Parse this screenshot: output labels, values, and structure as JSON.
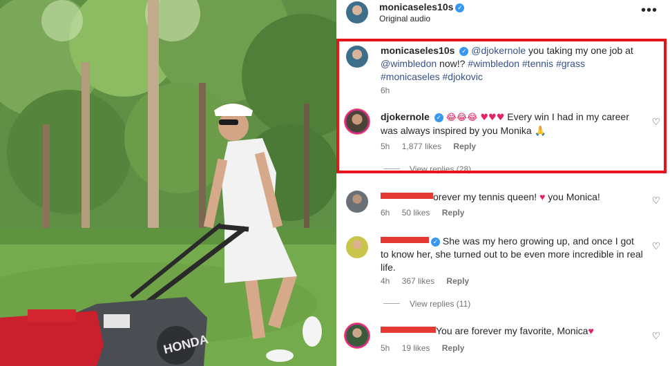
{
  "post": {
    "username": "monicaseles10s",
    "audio": "Original audio",
    "more_label": "•••"
  },
  "photo": {
    "mower_brand": "HONDA"
  },
  "comments": [
    {
      "username": "monicaseles10s",
      "text_parts": [
        "@djokernole",
        " you taking my one job at ",
        "@wimbledon",
        " now!? ",
        "#wimbledon",
        " ",
        "#tennis",
        " ",
        "#grass",
        " ",
        "#monicaseles",
        " ",
        "#djokovic"
      ],
      "time": "6h"
    },
    {
      "username": "djokernole",
      "emojis": "😂😂😂 ♥♥♥",
      "text": "Every win I had in my career was always inspired by you Monika 🙏",
      "time": "5h",
      "likes": "1,877 likes",
      "reply": "Reply",
      "view_replies": "View replies (28)"
    },
    {
      "text_before": "orever my tennis queen! ",
      "text_after": " you Monica!",
      "time": "6h",
      "likes": "50 likes",
      "reply": "Reply"
    },
    {
      "text": "She was my hero growing up, and once I got to know her, she turned out to be even more incredible in real life.",
      "time": "4h",
      "likes": "367 likes",
      "reply": "Reply",
      "view_replies": "View replies (11)"
    },
    {
      "text": "You are forever my favorite, Monica",
      "time": "5h",
      "likes": "19 likes",
      "reply": "Reply"
    }
  ],
  "colors": {
    "highlight_border": "#e8141c",
    "redaction": "#e53935",
    "link": "#385185",
    "verified": "#3897f0"
  }
}
